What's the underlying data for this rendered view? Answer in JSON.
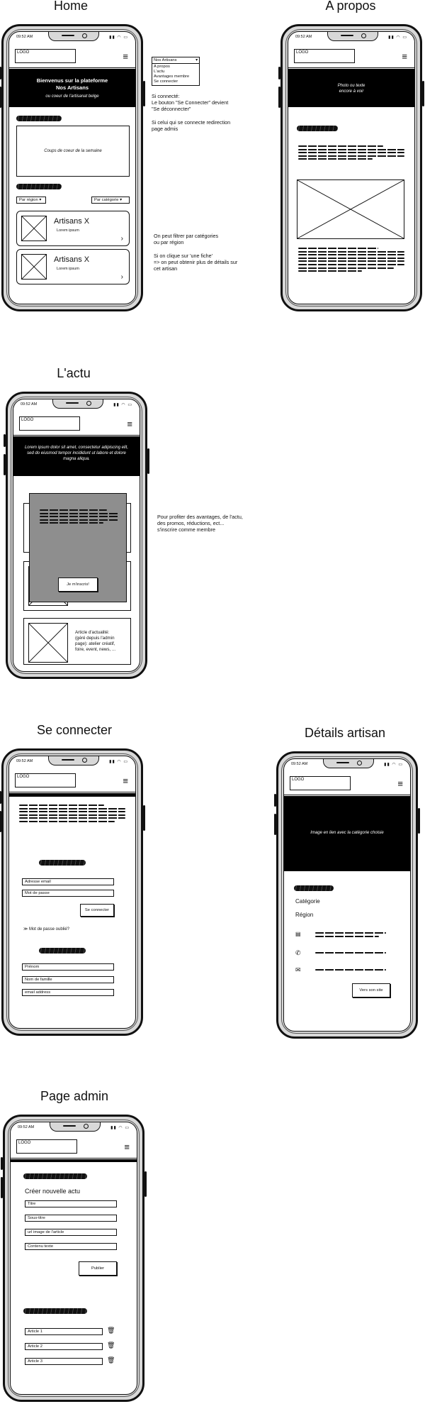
{
  "titles": {
    "home": "Home",
    "apropos": "A propos",
    "lactu": "L'actu",
    "connecter": "Se connecter",
    "details": "Détails artisan",
    "admin": "Page admin"
  },
  "status_time": "09:52 AM",
  "logo_label": "LOGO",
  "home": {
    "hero_title_1": "Bienvenus sur la plateforme",
    "hero_title_2": "Nos Artisans",
    "hero_sub": "ou coeur de l'artisanat belge",
    "featured": "Coups de coeur de la semaine",
    "filter_region": "Par région",
    "filter_category": "Par catégorie",
    "cards": [
      {
        "title": "Artisans X",
        "sub": "Lorem ipsum"
      },
      {
        "title": "Artisans X",
        "sub": "Lorem ipsum"
      }
    ]
  },
  "menu": {
    "selected": "Nos Artisans",
    "items": [
      "A propos",
      "L'actu",
      "Avantages membre",
      "Se connecter"
    ]
  },
  "notes": {
    "connect": "Si connecté:\nLe bouton \"Se Connecter\" devient\n\"Se déconnecter\"",
    "redirect": "Si celui qui se connecte redirection\npage admis",
    "filter": "On peut filtrer par catégories\nou par région",
    "fiche": "Si on clique sur 'une fiche'\n=> on peut obtenir plus de détails sur\ncet artisan",
    "member": "Pour profiter des avantages, de l'actu,\ndes promos, réductions, ect...\ns'inscrire comme membre"
  },
  "apropos": {
    "hero_1": "Photo ou texte",
    "hero_2": "encore à voir"
  },
  "lactu": {
    "hero": "Lorem ipsum dolor sit amet, consectetur adipiscing elit, sed do eiusmod tempor incididunt ut labore et dolore magna aliqua.",
    "modal_button": "Je m'inscris!",
    "article": "Article d'actualité:\n(géré depuis l'admin\npage): atelier créatif,\nfoire, event, news, ..."
  },
  "connect": {
    "email": "Adresse email",
    "password": "Mot de passe",
    "submit": "Se connecter",
    "forgot": "Mot de passe oublié?",
    "firstname": "Prénom",
    "lastname": "Nom de famille",
    "email2": "email address"
  },
  "details": {
    "hero": "Image en lien avec la catégorie choisie",
    "category": "Catégorie",
    "region": "Région",
    "site_button": "Vers son site"
  },
  "admin": {
    "create": "Créer nouvelle actu",
    "fields": [
      "Titre",
      "Sous-titre",
      "url image de l'article",
      "Contenu texte"
    ],
    "publish": "Publier",
    "articles": [
      "Article 1",
      "Article 2",
      "Article 3"
    ]
  }
}
